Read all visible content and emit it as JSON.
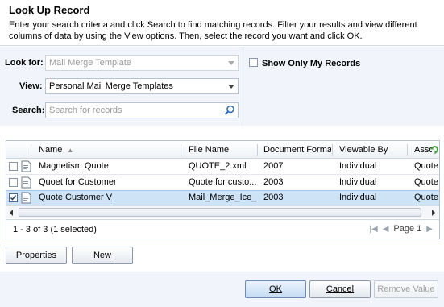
{
  "dialog": {
    "title": "Look Up Record",
    "description": "Enter your search criteria and click Search to find matching records. Filter your results and view different columns of data by using the View options. Then, select the record you want and click OK."
  },
  "criteria": {
    "look_for_label": "Look for:",
    "look_for_value": "Mail Merge Template",
    "view_label": "View:",
    "view_value": "Personal Mail Merge Templates",
    "search_label": "Search:",
    "search_placeholder": "Search for records",
    "show_only_mine_label": "Show Only My Records",
    "show_only_mine_checked": false
  },
  "grid": {
    "columns": [
      "Name",
      "File Name",
      "Document Format",
      "Viewable By",
      "Asso"
    ],
    "rows": [
      {
        "name": "Magnetism Quote",
        "file_name": "QUOTE_2.xml",
        "format": "2007",
        "viewable_by": "Individual",
        "associated": "Quote",
        "checked": false,
        "selected": false
      },
      {
        "name": "Quoet for Customer",
        "file_name": "Quote for custo...",
        "format": "2003",
        "viewable_by": "Individual",
        "associated": "Quote",
        "checked": false,
        "selected": false
      },
      {
        "name": "Quote Customer V",
        "file_name": "Mail_Merge_Ice_...",
        "format": "2003",
        "viewable_by": "Individual",
        "associated": "Quote",
        "checked": true,
        "selected": true
      }
    ],
    "record_count": "1 - 3 of 3 (1 selected)",
    "page_label": "Page 1"
  },
  "buttons": {
    "properties": "Properties",
    "new": "New",
    "ok": "OK",
    "cancel": "Cancel",
    "remove_value": "Remove Value"
  },
  "colors": {
    "selected_row": "#cfe3f7",
    "panel_bg": "#f1f5fb",
    "refresh_icon": "#3aa33a"
  }
}
